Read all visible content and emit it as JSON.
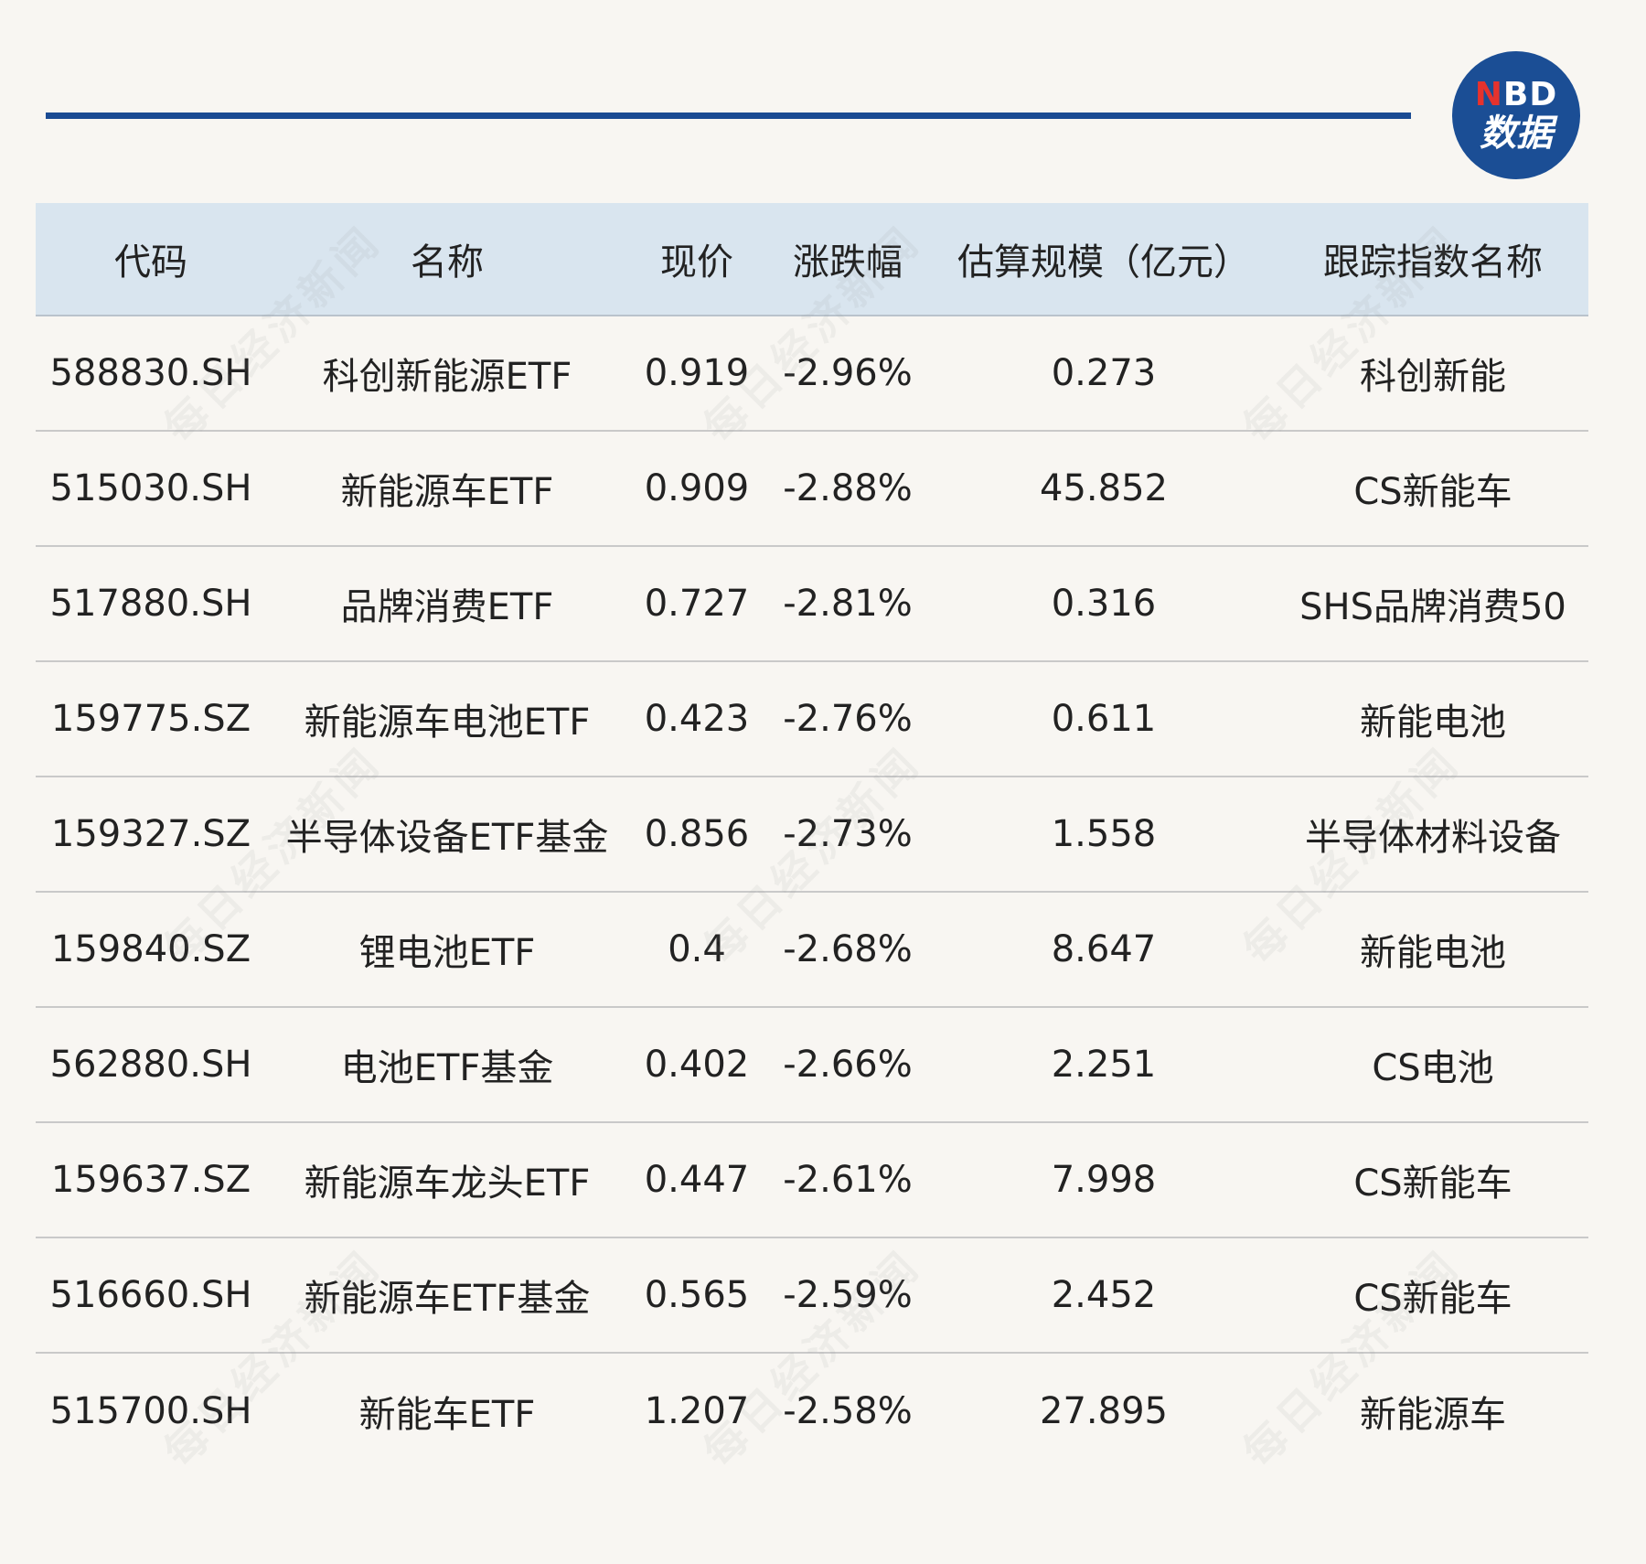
{
  "logo": {
    "top_text_n": "N",
    "top_text_rest": "BD",
    "bottom_text": "数据"
  },
  "watermark_text": "每日经济新闻",
  "colors": {
    "accent_blue": "#1a4b93",
    "header_bg": "#d9e5ef",
    "page_bg": "#f8f6f2",
    "logo_red": "#e6322d"
  },
  "table": {
    "headers": [
      "代码",
      "名称",
      "现价",
      "涨跌幅",
      "估算规模（亿元）",
      "跟踪指数名称"
    ],
    "rows": [
      [
        "588830.SH",
        "科创新能源ETF",
        "0.919",
        "-2.96%",
        "0.273",
        "科创新能"
      ],
      [
        "515030.SH",
        "新能源车ETF",
        "0.909",
        "-2.88%",
        "45.852",
        "CS新能车"
      ],
      [
        "517880.SH",
        "品牌消费ETF",
        "0.727",
        "-2.81%",
        "0.316",
        "SHS品牌消费50"
      ],
      [
        "159775.SZ",
        "新能源车电池ETF",
        "0.423",
        "-2.76%",
        "0.611",
        "新能电池"
      ],
      [
        "159327.SZ",
        "半导体设备ETF基金",
        "0.856",
        "-2.73%",
        "1.558",
        "半导体材料设备"
      ],
      [
        "159840.SZ",
        "锂电池ETF",
        "0.4",
        "-2.68%",
        "8.647",
        "新能电池"
      ],
      [
        "562880.SH",
        "电池ETF基金",
        "0.402",
        "-2.66%",
        "2.251",
        "CS电池"
      ],
      [
        "159637.SZ",
        "新能源车龙头ETF",
        "0.447",
        "-2.61%",
        "7.998",
        "CS新能车"
      ],
      [
        "516660.SH",
        "新能源车ETF基金",
        "0.565",
        "-2.59%",
        "2.452",
        "CS新能车"
      ],
      [
        "515700.SH",
        "新能车ETF",
        "1.207",
        "-2.58%",
        "27.895",
        "新能源车"
      ]
    ]
  }
}
